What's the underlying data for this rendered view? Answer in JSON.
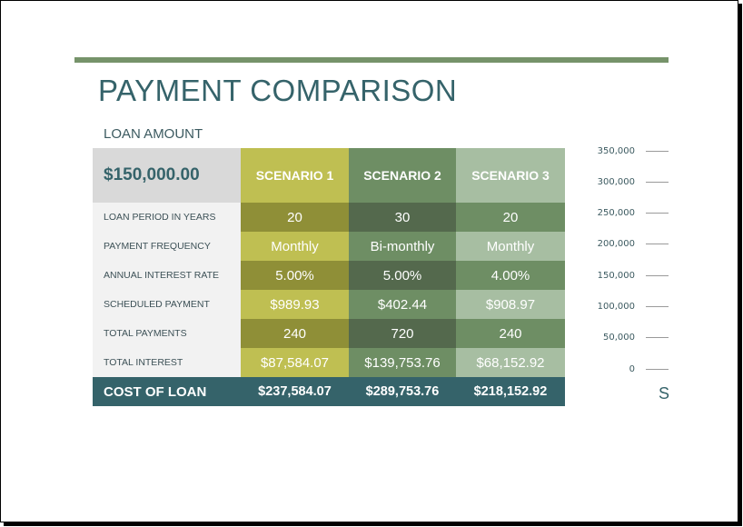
{
  "document": {
    "title": "PAYMENT COMPARISON",
    "loan_amount_label": "LOAN AMOUNT",
    "loan_amount_value": "$150,000.00",
    "colors": {
      "accent_rule": "#76936a",
      "title": "#35636a",
      "scenario1_light": "#bfbf52",
      "scenario1_dark": "#8f8f37",
      "scenario2_light": "#6e8e64",
      "scenario2_dark": "#54694d",
      "scenario3_light": "#a7bea2",
      "scenario3_dark": "#6e8e64",
      "total_row": "#35636a"
    }
  },
  "table": {
    "scenarios": [
      "SCENARIO 1",
      "SCENARIO 2",
      "SCENARIO 3"
    ],
    "rows": [
      {
        "label": "LOAN PERIOD IN YEARS",
        "values": [
          "20",
          "30",
          "20"
        ]
      },
      {
        "label": "PAYMENT FREQUENCY",
        "values": [
          "Monthly",
          "Bi-monthly",
          "Monthly"
        ]
      },
      {
        "label": "ANNUAL INTEREST RATE",
        "values": [
          "5.00%",
          "5.00%",
          "4.00%"
        ]
      },
      {
        "label": "SCHEDULED PAYMENT",
        "values": [
          "$989.93",
          "$402.44",
          "$908.97"
        ]
      },
      {
        "label": "TOTAL PAYMENTS",
        "values": [
          "240",
          "720",
          "240"
        ]
      },
      {
        "label": "TOTAL INTEREST",
        "values": [
          "$87,584.07",
          "$139,753.76",
          "$68,152.92"
        ]
      }
    ],
    "total": {
      "label": "COST OF LOAN",
      "values": [
        "$237,584.07",
        "$289,753.76",
        "$218,152.92"
      ]
    }
  },
  "chart_axis": {
    "ticks": [
      "350,000",
      "300,000",
      "250,000",
      "200,000",
      "150,000",
      "100,000",
      "50,000",
      "0"
    ],
    "partial_label": "S"
  }
}
